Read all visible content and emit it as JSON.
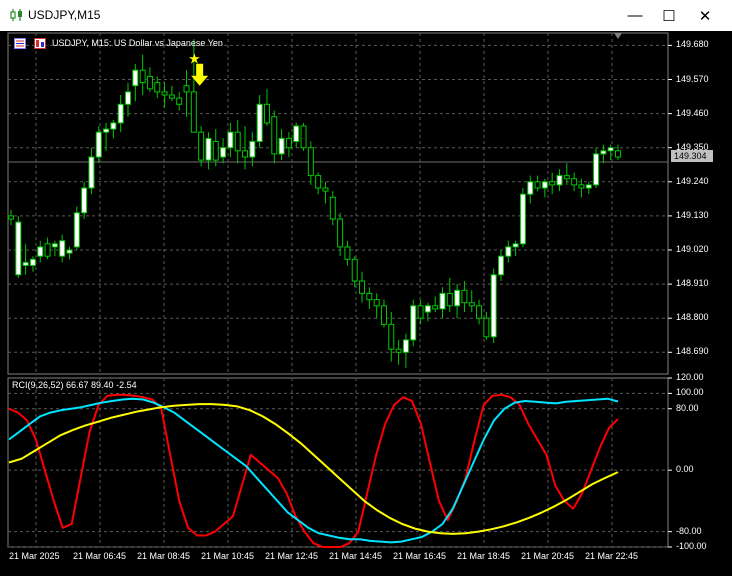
{
  "window": {
    "title": "USDJPY,M15",
    "minimize_glyph": "—",
    "maximize_glyph": "☐",
    "close_glyph": "✕"
  },
  "chart": {
    "header": "USDJPY, M15:  US Dollar vs Japanese Yen",
    "current_price": "149.304",
    "colors": {
      "background": "#000000",
      "grid": "#5a5a5a",
      "bull_candle": "#ffffff",
      "bear_candle": "#000000",
      "candle_outline": "#00c800",
      "signal": "#ffff00",
      "rci_short": "#ff0000",
      "rci_mid": "#00e5ff",
      "rci_long": "#ffff00"
    },
    "price_axis": [
      "149.680",
      "149.570",
      "149.460",
      "149.350",
      "149.240",
      "149.130",
      "149.020",
      "148.910",
      "148.800",
      "148.690"
    ],
    "time_axis": [
      "21 Mar 2025",
      "21 Mar 06:45",
      "21 Mar 08:45",
      "21 Mar 10:45",
      "21 Mar 12:45",
      "21 Mar 14:45",
      "21 Mar 16:45",
      "21 Mar 18:45",
      "21 Mar 20:45",
      "21 Mar 22:45"
    ]
  },
  "indicator": {
    "label": "RCI(9,26,52) 66.67 89.40 -2.54",
    "axis": [
      "120.00",
      "100.00",
      "80.00",
      "0.00",
      "-80.00",
      "-100.00"
    ]
  },
  "chart_data": {
    "type": "candlestick",
    "title": "USDJPY, M15:  US Dollar vs Japanese Yen",
    "ylim": [
      148.62,
      149.72
    ],
    "ohlc": [
      [
        149.13,
        149.15,
        149.1,
        149.12
      ],
      [
        148.94,
        149.13,
        148.93,
        149.11
      ],
      [
        148.97,
        149.04,
        148.94,
        148.98
      ],
      [
        148.97,
        149.0,
        148.95,
        148.99
      ],
      [
        149.0,
        149.05,
        148.98,
        149.03
      ],
      [
        149.04,
        149.06,
        148.99,
        149.0
      ],
      [
        149.03,
        149.05,
        149.0,
        149.04
      ],
      [
        149.0,
        149.07,
        148.98,
        149.05
      ],
      [
        149.01,
        149.03,
        148.99,
        149.02
      ],
      [
        149.03,
        149.16,
        149.02,
        149.14
      ],
      [
        149.14,
        149.24,
        149.12,
        149.22
      ],
      [
        149.22,
        149.35,
        149.2,
        149.32
      ],
      [
        149.32,
        149.42,
        149.3,
        149.4
      ],
      [
        149.4,
        149.43,
        149.34,
        149.41
      ],
      [
        149.41,
        149.44,
        149.38,
        149.43
      ],
      [
        149.43,
        149.52,
        149.4,
        149.49
      ],
      [
        149.49,
        149.56,
        149.45,
        149.53
      ],
      [
        149.55,
        149.62,
        149.5,
        149.6
      ],
      [
        149.6,
        149.65,
        149.52,
        149.56
      ],
      [
        149.58,
        149.61,
        149.53,
        149.54
      ],
      [
        149.56,
        149.58,
        149.51,
        149.53
      ],
      [
        149.53,
        149.56,
        149.48,
        149.52
      ],
      [
        149.52,
        149.55,
        149.5,
        149.51
      ],
      [
        149.51,
        149.53,
        149.47,
        149.49
      ],
      [
        149.55,
        149.6,
        149.45,
        149.53
      ],
      [
        149.53,
        149.7,
        149.41,
        149.4
      ],
      [
        149.4,
        149.42,
        149.29,
        149.31
      ],
      [
        149.31,
        149.4,
        149.28,
        149.38
      ],
      [
        149.37,
        149.41,
        149.29,
        149.31
      ],
      [
        149.32,
        149.38,
        149.3,
        149.35
      ],
      [
        149.35,
        149.43,
        149.32,
        149.4
      ],
      [
        149.4,
        149.44,
        149.3,
        149.34
      ],
      [
        149.34,
        149.42,
        149.28,
        149.32
      ],
      [
        149.32,
        149.4,
        149.29,
        149.37
      ],
      [
        149.37,
        149.52,
        149.35,
        149.49
      ],
      [
        149.49,
        149.54,
        149.42,
        149.43
      ],
      [
        149.45,
        149.47,
        149.3,
        149.33
      ],
      [
        149.33,
        149.41,
        149.31,
        149.38
      ],
      [
        149.38,
        149.4,
        149.32,
        149.35
      ],
      [
        149.37,
        149.43,
        149.35,
        149.42
      ],
      [
        149.42,
        149.43,
        149.34,
        149.35
      ],
      [
        149.35,
        149.37,
        149.23,
        149.26
      ],
      [
        149.26,
        149.27,
        149.2,
        149.22
      ],
      [
        149.22,
        149.24,
        149.17,
        149.21
      ],
      [
        149.19,
        149.21,
        149.1,
        149.12
      ],
      [
        149.12,
        149.14,
        149.0,
        149.03
      ],
      [
        149.03,
        149.05,
        148.97,
        148.99
      ],
      [
        148.99,
        149.0,
        148.9,
        148.92
      ],
      [
        148.92,
        148.95,
        148.85,
        148.88
      ],
      [
        148.88,
        148.9,
        148.83,
        148.86
      ],
      [
        148.86,
        148.88,
        148.8,
        148.84
      ],
      [
        148.84,
        148.86,
        148.77,
        148.78
      ],
      [
        148.78,
        148.82,
        148.66,
        148.7
      ],
      [
        148.7,
        148.73,
        148.65,
        148.69
      ],
      [
        148.69,
        148.75,
        148.64,
        148.73
      ],
      [
        148.73,
        148.86,
        148.71,
        148.84
      ],
      [
        148.84,
        148.86,
        148.78,
        148.8
      ],
      [
        148.82,
        148.85,
        148.79,
        148.84
      ],
      [
        148.84,
        148.87,
        148.82,
        148.83
      ],
      [
        148.83,
        148.9,
        148.8,
        148.88
      ],
      [
        148.88,
        148.93,
        148.82,
        148.84
      ],
      [
        148.84,
        148.91,
        148.8,
        148.89
      ],
      [
        148.89,
        148.92,
        148.82,
        148.85
      ],
      [
        148.85,
        148.89,
        148.82,
        148.84
      ],
      [
        148.84,
        148.86,
        148.78,
        148.8
      ],
      [
        148.8,
        148.82,
        148.73,
        148.74
      ],
      [
        148.74,
        148.96,
        148.72,
        148.94
      ],
      [
        148.94,
        149.02,
        148.92,
        149.0
      ],
      [
        149.0,
        149.05,
        148.98,
        149.03
      ],
      [
        149.03,
        149.05,
        149.0,
        149.04
      ],
      [
        149.04,
        149.22,
        149.03,
        149.2
      ],
      [
        149.2,
        149.26,
        149.17,
        149.24
      ],
      [
        149.24,
        149.26,
        149.21,
        149.22
      ],
      [
        149.22,
        149.25,
        149.19,
        149.24
      ],
      [
        149.24,
        149.27,
        149.2,
        149.23
      ],
      [
        149.23,
        149.28,
        149.21,
        149.26
      ],
      [
        149.26,
        149.3,
        149.23,
        149.25
      ],
      [
        149.25,
        149.27,
        149.21,
        149.23
      ],
      [
        149.23,
        149.25,
        149.19,
        149.22
      ],
      [
        149.22,
        149.24,
        149.2,
        149.23
      ],
      [
        149.23,
        149.35,
        149.22,
        149.33
      ],
      [
        149.33,
        149.36,
        149.3,
        149.34
      ],
      [
        149.34,
        149.36,
        149.31,
        149.35
      ],
      [
        149.34,
        149.36,
        149.31,
        149.32
      ]
    ],
    "rci": {
      "ylim": [
        -100,
        120
      ],
      "series": [
        {
          "name": "RCI(9)",
          "values": [
            80,
            75,
            65,
            40,
            0,
            -40,
            -75,
            -70,
            -10,
            50,
            85,
            97,
            98,
            98,
            97,
            95,
            92,
            80,
            20,
            -40,
            -75,
            -85,
            -85,
            -80,
            -70,
            -60,
            -20,
            20,
            10,
            0,
            -10,
            -30,
            -60,
            -80,
            -95,
            -100,
            -100,
            -100,
            -95,
            -80,
            -30,
            20,
            60,
            85,
            95,
            90,
            60,
            10,
            -40,
            -65,
            -40,
            -10,
            40,
            85,
            97,
            98,
            95,
            85,
            60,
            40,
            20,
            -20,
            -40,
            -50,
            -30,
            0,
            30,
            55,
            66.67
          ]
        },
        {
          "name": "RCI(26)",
          "values": [
            40,
            50,
            60,
            70,
            75,
            78,
            80,
            82,
            85,
            88,
            90,
            92,
            93,
            92,
            88,
            82,
            75,
            65,
            55,
            45,
            35,
            25,
            15,
            5,
            -10,
            -25,
            -40,
            -55,
            -65,
            -75,
            -82,
            -85,
            -88,
            -90,
            -90,
            -92,
            -93,
            -94,
            -93,
            -90,
            -87,
            -80,
            -70,
            -50,
            -20,
            10,
            40,
            65,
            80,
            88,
            90,
            89,
            88,
            87,
            89,
            90,
            91,
            92,
            93,
            89.4
          ]
        },
        {
          "name": "RCI(52)",
          "values": [
            10,
            15,
            25,
            35,
            45,
            52,
            58,
            63,
            68,
            72,
            76,
            79,
            82,
            84,
            85,
            86,
            86,
            85,
            83,
            78,
            70,
            60,
            48,
            35,
            20,
            5,
            -10,
            -25,
            -40,
            -52,
            -62,
            -70,
            -76,
            -80,
            -82,
            -83,
            -82,
            -80,
            -77,
            -73,
            -68,
            -62,
            -55,
            -47,
            -38,
            -28,
            -18,
            -10,
            -2.54
          ]
        }
      ]
    },
    "signal": {
      "candle_index": 26,
      "price": 149.55
    }
  }
}
